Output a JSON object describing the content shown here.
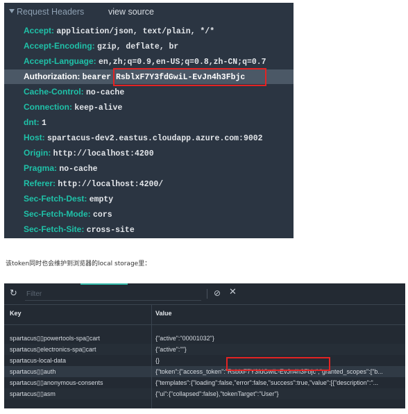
{
  "headers_panel": {
    "title": "Request Headers",
    "view_source": "view source",
    "rows": [
      {
        "key": "Accept:",
        "value": "application/json, text/plain, */*"
      },
      {
        "key": "Accept-Encoding:",
        "value": "gzip, deflate, br"
      },
      {
        "key": "Accept-Language:",
        "value": "en,zh;q=0.9,en-US;q=0.8,zh-CN;q=0.7"
      },
      {
        "key": "Authorization:",
        "value": "bearer RsblxF7Y3fdGwiL-EvJn4h3Fbjc"
      },
      {
        "key": "Cache-Control:",
        "value": "no-cache"
      },
      {
        "key": "Connection:",
        "value": "keep-alive"
      },
      {
        "key": "dnt:",
        "value": "1"
      },
      {
        "key": "Host:",
        "value": "spartacus-dev2.eastus.cloudapp.azure.com:9002"
      },
      {
        "key": "Origin:",
        "value": "http://localhost:4200"
      },
      {
        "key": "Pragma:",
        "value": "no-cache"
      },
      {
        "key": "Referer:",
        "value": "http://localhost:4200/"
      },
      {
        "key": "Sec-Fetch-Dest:",
        "value": "empty"
      },
      {
        "key": "Sec-Fetch-Mode:",
        "value": "cors"
      },
      {
        "key": "Sec-Fetch-Site:",
        "value": "cross-site"
      }
    ]
  },
  "caption": "该token同时也会维护到浏览器的local storage里：",
  "storage_panel": {
    "filter_placeholder": "Filter",
    "toolbar_icons": [
      "reload-icon",
      "clear-all-icon",
      "delete-icon"
    ],
    "columns": [
      "Key",
      "Value"
    ],
    "rows": [
      {
        "key": "spartacus▯▯powertools-spa▯cart",
        "value": "{\"active\":\"00001032\"}"
      },
      {
        "key": "spartacus▯electronics-spa▯cart",
        "value": "{\"active\":\"\"}"
      },
      {
        "key": "spartacus-local-data",
        "value": "{}"
      },
      {
        "key": "spartacus▯▯auth",
        "value": "{\"token\":{\"access_token\":\"RsblxF7Y3fdGwiL-EvJn4h3Fbjc\",\"granted_scopes\":[\"b..."
      },
      {
        "key": "spartacus▯▯anonymous-consents",
        "value": "{\"templates\":{\"loading\":false,\"error\":false,\"success\":true,\"value\":[{\"description\":\"..."
      },
      {
        "key": "spartacus▯▯asm",
        "value": "{\"ui\":{\"collapsed\":false},\"tokenTarget\":\"User\"}"
      }
    ]
  },
  "colors": {
    "header_panel_bg": "#2b3542",
    "header_key": "#1fc1a8",
    "selected_row_bg": "#4b5866",
    "storage_panel_bg": "#232a33",
    "highlight_box": "#e32323"
  }
}
